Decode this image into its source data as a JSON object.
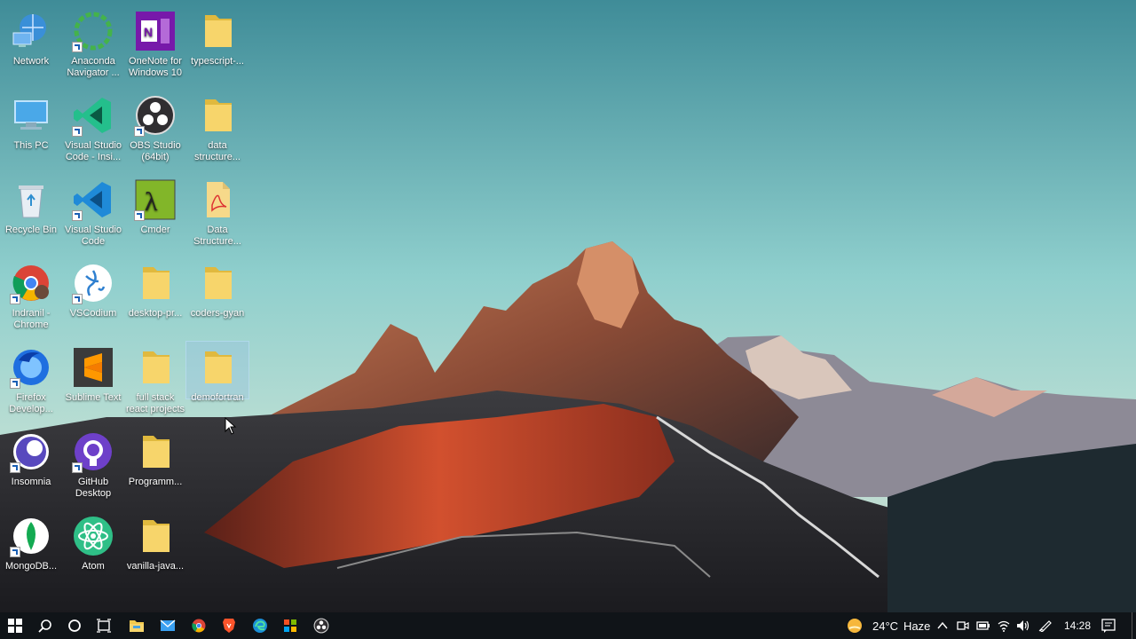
{
  "desktop": {
    "icons": [
      {
        "label": "Network",
        "icon": "network-icon"
      },
      {
        "label": "Anaconda Navigator ...",
        "icon": "anaconda-icon"
      },
      {
        "label": "OneNote for Windows 10",
        "icon": "onenote-icon"
      },
      {
        "label": "typescript-...",
        "icon": "folder-icon"
      },
      {
        "label": "This PC",
        "icon": "this-pc-icon"
      },
      {
        "label": "Visual Studio Code - Insi...",
        "icon": "vscode-insiders-icon"
      },
      {
        "label": "OBS Studio (64bit)",
        "icon": "obs-icon"
      },
      {
        "label": "data structure...",
        "icon": "folder-icon"
      },
      {
        "label": "Recycle Bin",
        "icon": "recycle-bin-icon"
      },
      {
        "label": "Visual Studio Code",
        "icon": "vscode-icon"
      },
      {
        "label": "Cmder",
        "icon": "cmder-icon"
      },
      {
        "label": "Data Structure...",
        "icon": "pdf-file-icon"
      },
      {
        "label": "Indranil - Chrome",
        "icon": "chrome-icon"
      },
      {
        "label": "VSCodium",
        "icon": "vscodium-icon"
      },
      {
        "label": "desktop-pr...",
        "icon": "folder-icon"
      },
      {
        "label": "coders-gyan",
        "icon": "folder-icon"
      },
      {
        "label": "Firefox Develop...",
        "icon": "firefox-dev-icon"
      },
      {
        "label": "Sublime Text",
        "icon": "sublime-icon"
      },
      {
        "label": "full stack react projects",
        "icon": "folder-icon"
      },
      {
        "label": "demofortran",
        "icon": "folder-icon"
      },
      {
        "label": "Insomnia",
        "icon": "insomnia-icon"
      },
      {
        "label": "GitHub Desktop",
        "icon": "github-icon"
      },
      {
        "label": "Programm...",
        "icon": "folder-icon"
      },
      {
        "label": "MongoDB...",
        "icon": "mongodb-icon"
      },
      {
        "label": "Atom",
        "icon": "atom-icon"
      },
      {
        "label": "vanilla-java...",
        "icon": "folder-icon"
      }
    ]
  },
  "taskbar": {
    "weather": {
      "temp": "24°C",
      "condition": "Haze"
    },
    "clock": "14:28",
    "pinned": [
      "start-icon",
      "search-icon",
      "cortana-icon",
      "task-view-icon",
      "file-explorer-icon",
      "mail-icon",
      "chrome-icon",
      "brave-icon",
      "edge-icon",
      "windows-store-icon",
      "obs-icon"
    ],
    "tray": [
      "chevron-up-icon",
      "meet-now-icon",
      "battery-icon",
      "wifi-icon",
      "volume-icon",
      "pen-icon",
      "notification-icon"
    ]
  }
}
